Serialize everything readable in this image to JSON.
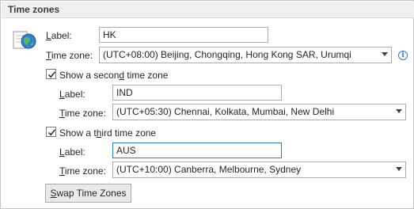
{
  "section": {
    "title": "Time zones"
  },
  "primary": {
    "label_caption_pre": "",
    "label_caption_key": "L",
    "label_caption_post": "abel:",
    "label_value": "HK",
    "zone_caption_pre": "",
    "zone_caption_key": "T",
    "zone_caption_post": "ime zone:",
    "zone_value": "(UTC+08:00) Beijing, Chongqing, Hong Kong SAR, Urumqi",
    "info_glyph": "i"
  },
  "second": {
    "checkbox_checked": true,
    "checkbox_caption_pre": "Show a secon",
    "checkbox_caption_key": "d",
    "checkbox_caption_post": " time zone",
    "label_caption_pre": "",
    "label_caption_key": "L",
    "label_caption_post": "abel:",
    "label_value": "IND",
    "zone_caption_pre": "",
    "zone_caption_key": "T",
    "zone_caption_post": "ime zone:",
    "zone_value": "(UTC+05:30) Chennai, Kolkata, Mumbai, New Delhi"
  },
  "third": {
    "checkbox_checked": true,
    "checkbox_caption_pre": "Show a t",
    "checkbox_caption_key": "h",
    "checkbox_caption_post": "ird time zone",
    "label_caption_pre": "",
    "label_caption_key": "L",
    "label_caption_post": "abel:",
    "label_value": "AUS",
    "zone_caption_pre": "",
    "zone_caption_key": "T",
    "zone_caption_post": "ime zone:",
    "zone_value": "(UTC+10:00) Canberra, Melbourne, Sydney"
  },
  "swap_button": {
    "pre": "",
    "key": "S",
    "post": "wap Time Zones"
  },
  "icons": {
    "globe": "globe-clock-icon",
    "info": "info-icon",
    "check": "checkmark-icon",
    "dropdown": "chevron-down-icon"
  },
  "colors": {
    "accent": "#2b79d0",
    "header_bg": "#f0f0f0"
  }
}
